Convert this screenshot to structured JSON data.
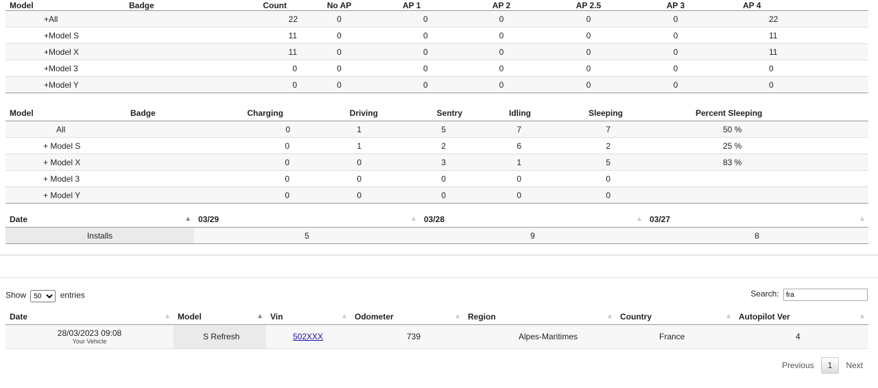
{
  "ap_table": {
    "headers": [
      "Model",
      "Badge",
      "Count",
      "No AP",
      "AP 1",
      "AP 2",
      "AP 2.5",
      "AP 3",
      "AP 4"
    ],
    "rows": [
      [
        "+All",
        "22",
        "0",
        "0",
        "0",
        "0",
        "0",
        "22"
      ],
      [
        "+Model S",
        "11",
        "0",
        "0",
        "0",
        "0",
        "0",
        "11"
      ],
      [
        "+Model X",
        "11",
        "0",
        "0",
        "0",
        "0",
        "0",
        "11"
      ],
      [
        "+Model 3",
        "0",
        "0",
        "0",
        "0",
        "0",
        "0",
        "0"
      ],
      [
        "+Model Y",
        "0",
        "0",
        "0",
        "0",
        "0",
        "0",
        "0"
      ]
    ]
  },
  "state_table": {
    "headers": [
      "Model",
      "Badge",
      "Charging",
      "Driving",
      "Sentry",
      "Idling",
      "Sleeping",
      "Percent Sleeping"
    ],
    "rows": [
      [
        "All",
        "0",
        "1",
        "5",
        "7",
        "7",
        "50 %"
      ],
      [
        "+ Model S",
        "0",
        "1",
        "2",
        "6",
        "2",
        "25 %"
      ],
      [
        "+ Model X",
        "0",
        "0",
        "3",
        "1",
        "5",
        "83 %"
      ],
      [
        "+ Model 3",
        "0",
        "0",
        "0",
        "0",
        "0",
        ""
      ],
      [
        "+ Model Y",
        "0",
        "0",
        "0",
        "0",
        "0",
        ""
      ]
    ]
  },
  "installs_table": {
    "headers": [
      "Date",
      "03/29",
      "03/28",
      "03/27"
    ],
    "row_label": "Installs",
    "values": [
      "5",
      "9",
      "8"
    ]
  },
  "datatable": {
    "show_label": "Show",
    "entries_label": "entries",
    "page_length": "50",
    "search_label": "Search:",
    "search_value": "fra",
    "headers": [
      "Date",
      "Model",
      "Vin",
      "Odometer",
      "Region",
      "Country",
      "Autopilot Ver"
    ],
    "rows": [
      {
        "date": "28/03/2023 09:08",
        "sub": "Your Vehicle",
        "model": "S Refresh",
        "vin": "502XXX",
        "odometer": "739",
        "region": "Alpes-Maritimes",
        "country": "France",
        "autopilot": "4"
      }
    ],
    "pager": {
      "previous": "Previous",
      "page": "1",
      "next": "Next"
    }
  }
}
